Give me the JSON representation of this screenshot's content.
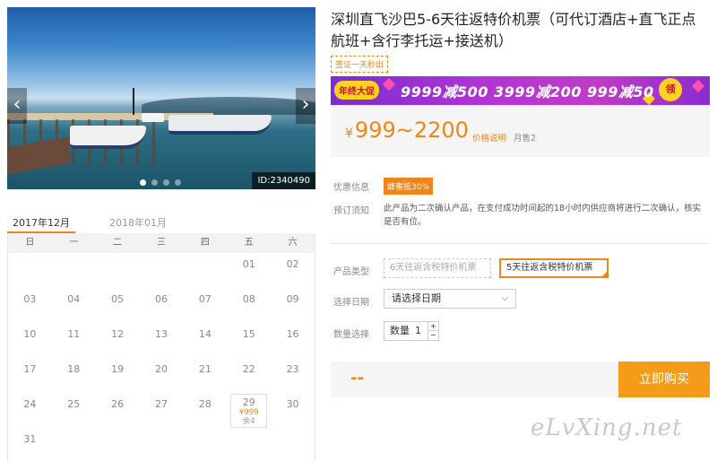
{
  "gallery": {
    "photo_id": "ID:2340490",
    "prev_arrow": "‹",
    "next_arrow": "›",
    "active_dot_index": 0,
    "dot_count": 4
  },
  "calendar": {
    "months": [
      "2017年12月",
      "2018年01月"
    ],
    "active_month": 0,
    "weekdays": [
      "日",
      "一",
      "二",
      "三",
      "四",
      "五",
      "六"
    ],
    "leading_blanks": 5,
    "days": [
      "01",
      "02",
      "03",
      "04",
      "05",
      "06",
      "07",
      "08",
      "09",
      "10",
      "11",
      "12",
      "13",
      "14",
      "15",
      "16",
      "17",
      "18",
      "19",
      "20",
      "21",
      "22",
      "23",
      "24",
      "25",
      "26",
      "27",
      "28",
      "29",
      "30",
      "31"
    ],
    "available": {
      "day": "29",
      "price": "¥999",
      "stock": "余4"
    }
  },
  "product": {
    "title": "深圳直飞沙巴5-6天往返特价机票（可代订酒店+直飞正点航班+含行李托运+接送机）",
    "visa_tag": "签证一天秒出"
  },
  "promo": {
    "badge": "年终大促",
    "text": "9999减500  3999减200  999减50",
    "get": "领"
  },
  "price": {
    "currency": "¥",
    "range": "999~2200",
    "note": "价格说明",
    "monthly_sales": "月售2"
  },
  "labels": {
    "discount": "优惠信息",
    "notice": "预订须知",
    "product_type": "产品类型",
    "select_date": "选择日期",
    "quantity_select": "数量选择"
  },
  "discount_badge": "蜂蜜抵30%",
  "notice_text": "此产品为二次确认产品，在支付成功时间起的18小时内供应商将进行二次确认，核实是否有位。",
  "product_types": [
    {
      "label": "6天往返含税特价机票",
      "state": "disabled"
    },
    {
      "label": "5天往返含税特价机票",
      "state": "selected"
    }
  ],
  "date_select": {
    "placeholder": "请选择日期",
    "chevron": "⌵"
  },
  "quantity": {
    "label": "数量",
    "value": "1",
    "up": "+",
    "down": "−"
  },
  "buy": {
    "total": "--",
    "button": "立即购买"
  },
  "watermark": "eLvXing.net",
  "colors": {
    "accent": "#f08519",
    "promo_bg": "#b134d6",
    "buy_button": "#f49b1a"
  }
}
